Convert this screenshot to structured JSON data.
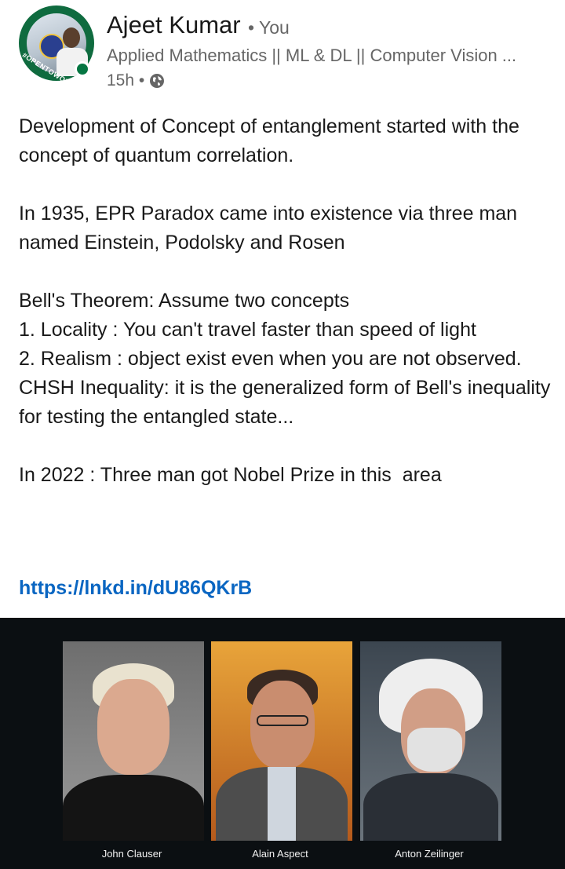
{
  "author": {
    "name": "Ajeet Kumar",
    "relation": "• You",
    "headline": "Applied Mathematics || ML & DL || Computer Vision ...",
    "time": "15h •",
    "badge_text": "#OPENTOWORK"
  },
  "post": {
    "paragraphs": [
      "Development of Concept of entanglement started with the concept of quantum correlation.",
      "In 1935, EPR Paradox came into existence via three man named Einstein, Podolsky and Rosen",
      "Bell's Theorem: Assume two concepts\n1. Locality : You can't travel faster than speed of light\n2. Realism : object exist even when you are not observed.\nCHSH Inequality: it is the generalized form of Bell's inequality for testing the entangled state...",
      "In 2022 : Three man got Nobel Prize in this  area"
    ],
    "link": "https://lnkd.in/dU86QKrB"
  },
  "image": {
    "captions": [
      "John Clauser",
      "Alain Aspect",
      "Anton Zeilinger"
    ]
  },
  "colors": {
    "link": "#0a66c2",
    "online": "#057642",
    "secondary_text": "#666666"
  }
}
